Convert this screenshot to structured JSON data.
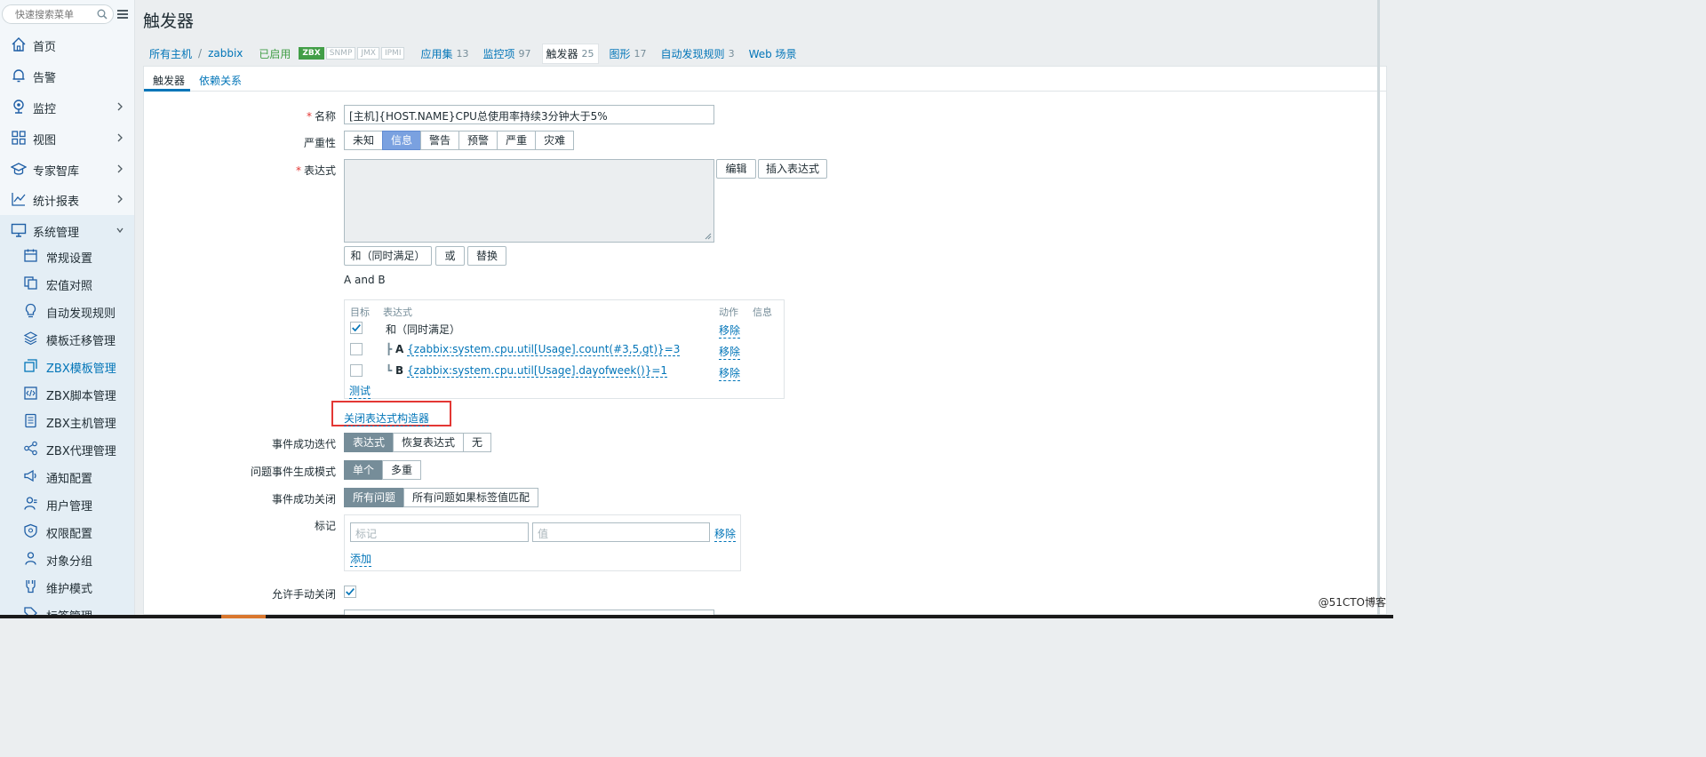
{
  "sidebar": {
    "search_placeholder": "快速搜索菜单",
    "items": [
      {
        "label": "首页",
        "icon": "home-icon"
      },
      {
        "label": "告警",
        "icon": "bell-icon"
      },
      {
        "label": "监控",
        "icon": "monitor-camera-icon"
      },
      {
        "label": "视图",
        "icon": "grid-icon"
      },
      {
        "label": "专家智库",
        "icon": "graduation-cap-icon"
      },
      {
        "label": "统计报表",
        "icon": "line-chart-icon"
      },
      {
        "label": "系统管理",
        "icon": "desktop-icon"
      }
    ],
    "sub_items": [
      {
        "label": "常规设置",
        "icon": "calendar-icon"
      },
      {
        "label": "宏值对照",
        "icon": "copy-icon"
      },
      {
        "label": "自动发现规则",
        "icon": "bulb-icon"
      },
      {
        "label": "模板迁移管理",
        "icon": "layers-icon"
      },
      {
        "label": "ZBX模板管理",
        "icon": "template-icon"
      },
      {
        "label": "ZBX脚本管理",
        "icon": "script-icon"
      },
      {
        "label": "ZBX主机管理",
        "icon": "server-icon"
      },
      {
        "label": "ZBX代理管理",
        "icon": "proxy-icon"
      },
      {
        "label": "通知配置",
        "icon": "megaphone-icon"
      },
      {
        "label": "用户管理",
        "icon": "user-icon"
      },
      {
        "label": "权限配置",
        "icon": "shield-icon"
      },
      {
        "label": "对象分组",
        "icon": "group-icon"
      },
      {
        "label": "维护模式",
        "icon": "wrench-icon"
      },
      {
        "label": "标签管理",
        "icon": "tag-icon"
      }
    ]
  },
  "page": {
    "title": "触发器"
  },
  "hostnav": {
    "all_hosts": "所有主机",
    "separator": "/",
    "host": "zabbix",
    "enabled": "已启用",
    "badges": [
      "ZBX",
      "SNMP",
      "JMX",
      "IPMI"
    ],
    "links": [
      {
        "label": "应用集",
        "count": "13"
      },
      {
        "label": "监控项",
        "count": "97"
      },
      {
        "label": "触发器",
        "count": "25"
      },
      {
        "label": "图形",
        "count": "17"
      },
      {
        "label": "自动发现规则",
        "count": "3"
      },
      {
        "label": "Web 场景",
        "count": ""
      }
    ]
  },
  "tabs": [
    "触发器",
    "依赖关系"
  ],
  "form": {
    "name_label": "名称",
    "name_value": "[主机]{HOST.NAME}CPU总使用率持续3分钟大于5%",
    "severity_label": "严重性",
    "severities": [
      "未知",
      "信息",
      "警告",
      "预警",
      "严重",
      "灾难"
    ],
    "severity_selected": "信息",
    "expression_label": "表达式",
    "edit_button": "编辑",
    "insert_expression_button": "插入表达式",
    "and_button": "和（同时满足）",
    "or_button": "或",
    "replace_button": "替换",
    "expression_text": "A and B",
    "expr_table": {
      "headers": [
        "目标",
        "表达式",
        "动作",
        "信息"
      ],
      "rows": [
        {
          "label": "和（同时满足）",
          "prefix": "",
          "expr": "",
          "checked": true,
          "action": "移除"
        },
        {
          "label": "",
          "prefix": "A",
          "expr": "{zabbix:system.cpu.util[Usage].count(#3,5,gt)}=3",
          "checked": false,
          "action": "移除"
        },
        {
          "label": "",
          "prefix": "B",
          "expr": "{zabbix:system.cpu.util[Usage].dayofweek()}=1",
          "checked": false,
          "action": "移除"
        }
      ],
      "test_link": "测试"
    },
    "close_builder_link": "关闭表达式构造器",
    "ok_event_gen_label": "事件成功迭代",
    "ok_event_gen_options": [
      "表达式",
      "恢复表达式",
      "无"
    ],
    "ok_event_gen_selected": "表达式",
    "problem_mode_label": "问题事件生成模式",
    "problem_mode_options": [
      "单个",
      "多重"
    ],
    "problem_mode_selected": "单个",
    "ok_close_label": "事件成功关闭",
    "ok_close_options": [
      "所有问题",
      "所有问题如果标签值匹配"
    ],
    "ok_close_selected": "所有问题",
    "tags_label": "标记",
    "tag_placeholder": "标记",
    "value_placeholder": "值",
    "tag_remove": "移除",
    "tag_add": "添加",
    "manual_close_label": "允许手动关闭",
    "manual_close_checked": true
  },
  "watermark": "@51CTO博客",
  "colors": {
    "link": "#0275b8",
    "enabled": "#429e47",
    "selected_severity": "#7aa1e0",
    "selected_segment": "#768d99",
    "highlight_box": "#e33734"
  }
}
